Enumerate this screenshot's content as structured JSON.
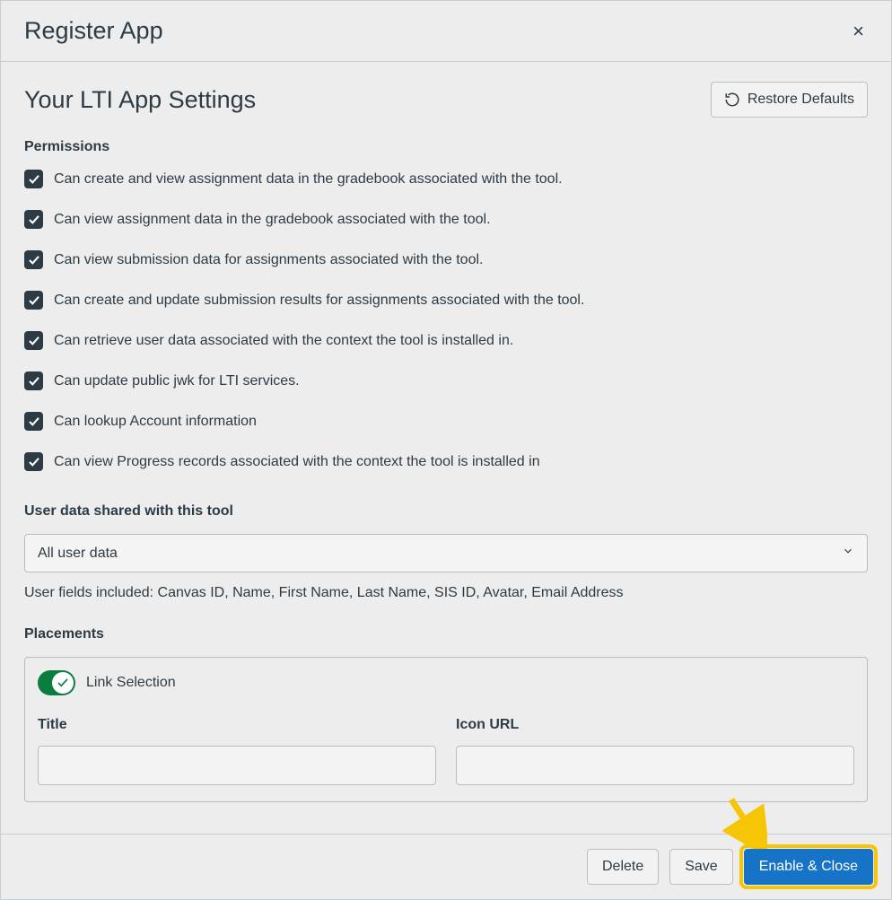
{
  "modal": {
    "title": "Register App",
    "close_label": "×"
  },
  "settings": {
    "title": "Your LTI App Settings",
    "restore_label": "Restore Defaults"
  },
  "permissions": {
    "heading": "Permissions",
    "items": [
      "Can create and view assignment data in the gradebook associated with the tool.",
      "Can view assignment data in the gradebook associated with the tool.",
      "Can view submission data for assignments associated with the tool.",
      "Can create and update submission results for assignments associated with the tool.",
      "Can retrieve user data associated with the context the tool is installed in.",
      "Can update public jwk for LTI services.",
      "Can lookup Account information",
      "Can view Progress records associated with the context the tool is installed in"
    ]
  },
  "user_data": {
    "heading": "User data shared with this tool",
    "selected": "All user data",
    "helper_text": "User fields included: Canvas ID, Name, First Name, Last Name, SIS ID, Avatar, Email Address"
  },
  "placements": {
    "heading": "Placements",
    "toggle_label": "Link Selection",
    "title_label": "Title",
    "title_value": "",
    "icon_url_label": "Icon URL",
    "icon_url_value": ""
  },
  "footer": {
    "delete_label": "Delete",
    "save_label": "Save",
    "enable_close_label": "Enable & Close"
  },
  "annotation": {
    "highlight_target": "enable-close-button"
  }
}
